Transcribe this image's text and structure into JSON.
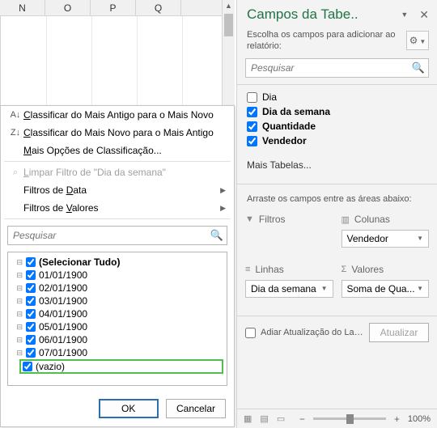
{
  "columns": [
    "N",
    "O",
    "P",
    "Q"
  ],
  "menu": {
    "sort_asc": "lassificar do Mais Antigo para o Mais Novo",
    "sort_asc_u": "C",
    "sort_desc": "lassificar do Mais Novo para o Mais Antigo",
    "sort_desc_u": "C",
    "more_sort": "ais Opções de Classificação...",
    "more_sort_u": "M",
    "clear_filter": "impar Filtro de \"Dia da semana\"",
    "clear_filter_u": "L",
    "date_filters": "ata",
    "date_filters_pre": "Filtros de ",
    "date_filters_u": "D",
    "value_filters": "alores",
    "value_filters_pre": "Filtros de ",
    "value_filters_u": "V",
    "search_ph": "Pesquisar",
    "tree": [
      {
        "label": "(Selecionar Tudo)",
        "checked": true,
        "bold": true
      },
      {
        "label": "01/01/1900",
        "checked": true
      },
      {
        "label": "02/01/1900",
        "checked": true
      },
      {
        "label": "03/01/1900",
        "checked": true
      },
      {
        "label": "04/01/1900",
        "checked": true
      },
      {
        "label": "05/01/1900",
        "checked": true
      },
      {
        "label": "06/01/1900",
        "checked": true
      },
      {
        "label": "07/01/1900",
        "checked": true
      },
      {
        "label": "(vazio)",
        "checked": true,
        "hilite": true
      }
    ],
    "ok": "OK",
    "cancel": "Cancelar"
  },
  "pane": {
    "title": "Campos da Tabe..",
    "subtitle": "Escolha os campos para adicionar ao relatório:",
    "search_ph": "Pesquisar",
    "fields": [
      {
        "label": "Dia",
        "checked": false,
        "bold": false
      },
      {
        "label": "Dia da semana",
        "checked": true,
        "bold": true
      },
      {
        "label": "Quantidade",
        "checked": true,
        "bold": true
      },
      {
        "label": "Vendedor",
        "checked": true,
        "bold": true
      }
    ],
    "more_tables": "Mais Tabelas...",
    "drag_hint": "Arraste os campos entre as áreas abaixo:",
    "areas": {
      "filters": "Filtros",
      "columns": "Colunas",
      "rows": "Linhas",
      "values": "Valores",
      "columns_chip": "Vendedor",
      "rows_chip": "Dia da semana",
      "values_chip": "Soma de Qua..."
    },
    "defer": "Adiar Atualização do Lay...",
    "update": "Atualizar"
  },
  "status": {
    "zoom": "100%"
  }
}
